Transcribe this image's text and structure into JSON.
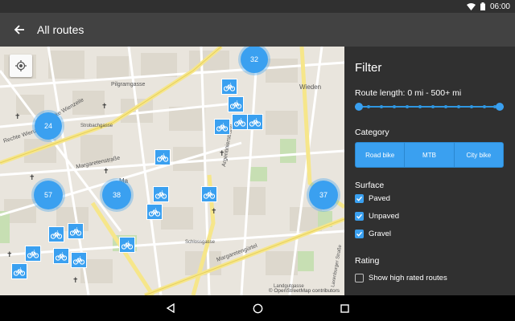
{
  "status": {
    "time": "06:00",
    "icons": [
      "wifi-icon",
      "battery-icon"
    ]
  },
  "appbar": {
    "title": "All routes",
    "back_icon": "arrow-back-icon"
  },
  "map": {
    "labels": [
      "Pilgramgasse",
      "Wieden",
      "Margaretenstraße",
      "Margaretengürtel",
      "Rechte Wienzeile",
      "Linke Wienzeile",
      "Argentinierstraße",
      "Ma",
      "Landgutgasse",
      "Laxenburger Straße",
      "Strobachgasse",
      "Schlossgasse"
    ],
    "attribution": "© OpenStreetMap contributors",
    "clusters": [
      {
        "name": "cluster-32",
        "count": "32"
      },
      {
        "name": "cluster-24",
        "count": "24"
      },
      {
        "name": "cluster-57",
        "count": "57"
      },
      {
        "name": "cluster-38",
        "count": "38"
      },
      {
        "name": "cluster-37",
        "count": "37"
      }
    ],
    "locate_icon": "my-location-icon"
  },
  "filter": {
    "title": "Filter",
    "route_length": "Route length: 0 mi - 500+ mi",
    "range": {
      "min": 0,
      "max": 500,
      "low": 0,
      "high": 500
    },
    "category_label": "Category",
    "categories": [
      "Road bike",
      "MTB",
      "City bike"
    ],
    "surface_label": "Surface",
    "surfaces": [
      {
        "label": "Paved",
        "checked": true
      },
      {
        "label": "Unpaved",
        "checked": true
      },
      {
        "label": "Gravel",
        "checked": true
      }
    ],
    "rating_label": "Rating",
    "rating_option": {
      "label": "Show high rated routes",
      "checked": false
    }
  },
  "colors": {
    "accent": "#3aa0f0",
    "panel": "#303030",
    "appbar": "#424242"
  },
  "navbar": {
    "icons": [
      "back-triangle-icon",
      "home-circle-icon",
      "recents-square-icon"
    ]
  }
}
